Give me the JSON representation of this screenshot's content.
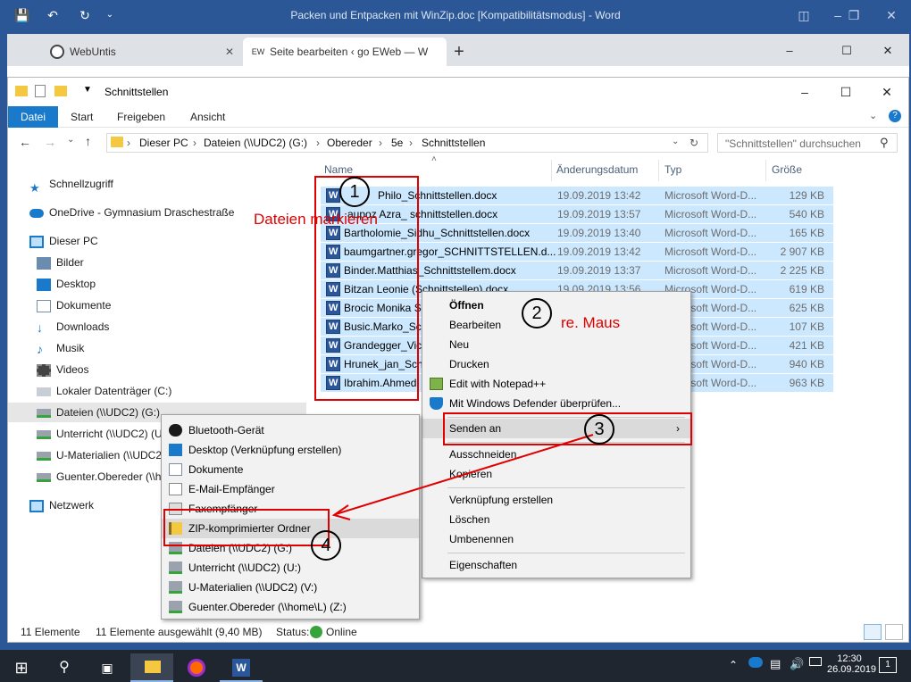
{
  "word": {
    "title": "Packen und Entpacken mit WinZip.doc [Kompatibilitätsmodus] - Word"
  },
  "browser": {
    "tabs": [
      {
        "label": "WebUntis"
      },
      {
        "label": "Seite bearbeiten ‹ go EWeb — W"
      }
    ],
    "new_tab": "+"
  },
  "explorer": {
    "title": "Schnittstellen",
    "ribbon_tabs": [
      "Datei",
      "Start",
      "Freigeben",
      "Ansicht"
    ],
    "address": [
      "Dieser PC",
      "Dateien (\\\\UDC2) (G:)",
      "Obereder",
      "5e",
      "Schnittstellen"
    ],
    "search_placeholder": "\"Schnittstellen\" durchsuchen",
    "columns": {
      "name": "Name",
      "date": "Änderungsdatum",
      "type": "Typ",
      "size": "Größe"
    },
    "nav": [
      {
        "label": "Schnellzugriff",
        "icon": "star-icon"
      },
      {
        "label": "OneDrive - Gymnasium Draschestraße",
        "icon": "onedrive-icon"
      },
      {
        "label": "Dieser PC",
        "icon": "pc-icon"
      },
      {
        "label": "Bilder",
        "icon": "pictures-icon"
      },
      {
        "label": "Desktop",
        "icon": "desktop-icon"
      },
      {
        "label": "Dokumente",
        "icon": "documents-icon"
      },
      {
        "label": "Downloads",
        "icon": "download-icon"
      },
      {
        "label": "Musik",
        "icon": "music-icon"
      },
      {
        "label": "Videos",
        "icon": "videos-icon"
      },
      {
        "label": "Lokaler Datenträger (C:)",
        "icon": "drive-icon"
      },
      {
        "label": "Dateien (\\\\UDC2) (G:)",
        "icon": "network-drive-icon"
      },
      {
        "label": "Unterricht (\\\\UDC2) (U:)",
        "icon": "network-drive-icon"
      },
      {
        "label": "U-Materialien (\\\\UDC2)",
        "icon": "network-drive-icon"
      },
      {
        "label": "Guenter.Obereder (\\\\h",
        "icon": "network-drive-icon"
      },
      {
        "label": "Netzwerk",
        "icon": "network-icon"
      }
    ],
    "files": [
      {
        "name": "Philo_Schnittstellen.docx",
        "date": "19.09.2019 13:42",
        "type": "Microsoft Word-D...",
        "size": "129 KB"
      },
      {
        "name": "aupoz Azra_ schnittstellen.docx",
        "date": "19.09.2019 13:57",
        "type": "Microsoft Word-D...",
        "size": "540 KB"
      },
      {
        "name": "Bartholomie_Sidhu_Schnittstellen.docx",
        "date": "19.09.2019 13:40",
        "type": "Microsoft Word-D...",
        "size": "165 KB"
      },
      {
        "name": "baumgartner.gregor_SCHNITTSTELLEN.d...",
        "date": "19.09.2019 13:42",
        "type": "Microsoft Word-D...",
        "size": "2 907 KB"
      },
      {
        "name": "Binder.Matthias_Schnittstellem.docx",
        "date": "19.09.2019 13:37",
        "type": "Microsoft Word-D...",
        "size": "2 225 KB"
      },
      {
        "name": "Bitzan Leonie (Schnittstellen).docx",
        "date": "19.09.2019 13:56",
        "type": "Microsoft Word-D...",
        "size": "619 KB"
      },
      {
        "name": "Brocic Monika S",
        "date": "",
        "type": "Microsoft Word-D...",
        "size": "625 KB"
      },
      {
        "name": "Busic.Marko_Sc",
        "date": "",
        "type": "Microsoft Word-D...",
        "size": "107 KB"
      },
      {
        "name": "Grandegger_Vic",
        "date": "",
        "type": "Microsoft Word-D...",
        "size": "421 KB"
      },
      {
        "name": "Hrunek_jan_Sch",
        "date": "",
        "type": "Microsoft Word-D...",
        "size": "940 KB"
      },
      {
        "name": "Ibrahim.Ahmed",
        "date": "",
        "type": "Microsoft Word-D...",
        "size": "963 KB"
      }
    ],
    "status": {
      "count": "11 Elemente",
      "selected": "11 Elemente ausgewählt (9,40 MB)",
      "status_label": "Status:",
      "status_value": "Online"
    }
  },
  "context_menu": [
    {
      "label": "Öffnen",
      "bold": true
    },
    {
      "label": "Bearbeiten"
    },
    {
      "label": "Neu"
    },
    {
      "label": "Drucken"
    },
    {
      "label": "Edit with Notepad++",
      "icon": "notepad-icon"
    },
    {
      "label": "Mit Windows Defender überprüfen...",
      "icon": "defender-icon"
    },
    {
      "label": "Senden an",
      "submenu": true
    },
    {
      "label": "Ausschneiden"
    },
    {
      "label": "Kopieren"
    },
    {
      "label": "Verknüpfung erstellen"
    },
    {
      "label": "Löschen"
    },
    {
      "label": "Umbenennen"
    },
    {
      "label": "Eigenschaften"
    }
  ],
  "sendto_menu": [
    {
      "label": "Bluetooth-Gerät",
      "icon": "bluetooth-icon"
    },
    {
      "label": "Desktop (Verknüpfung erstellen)",
      "icon": "desktop-icon"
    },
    {
      "label": "Dokumente",
      "icon": "documents-icon"
    },
    {
      "label": "E-Mail-Empfänger",
      "icon": "mail-icon"
    },
    {
      "label": "Faxempfänger",
      "icon": "fax-icon"
    },
    {
      "label": "ZIP-komprimierter Ordner",
      "icon": "zip-folder-icon"
    },
    {
      "label": "Dateien (\\\\UDC2) (G:)",
      "icon": "network-drive-icon"
    },
    {
      "label": "Unterricht (\\\\UDC2) (U:)",
      "icon": "network-drive-icon"
    },
    {
      "label": "U-Materialien (\\\\UDC2) (V:)",
      "icon": "network-drive-icon"
    },
    {
      "label": "Guenter.Obereder (\\\\home\\L) (Z:)",
      "icon": "network-drive-icon"
    }
  ],
  "annotations": {
    "step1": "1",
    "step2": "2",
    "step3": "3",
    "step4": "4",
    "label1": "Dateien markieren",
    "label2": "re. Maus"
  },
  "taskbar": {
    "time": "12:30",
    "date": "26.09.2019",
    "notifications": "1"
  },
  "colors": {
    "word_blue": "#2b5797",
    "selection": "#cce8ff",
    "accent": "#1979ca",
    "annotation_red": "#e00000"
  }
}
